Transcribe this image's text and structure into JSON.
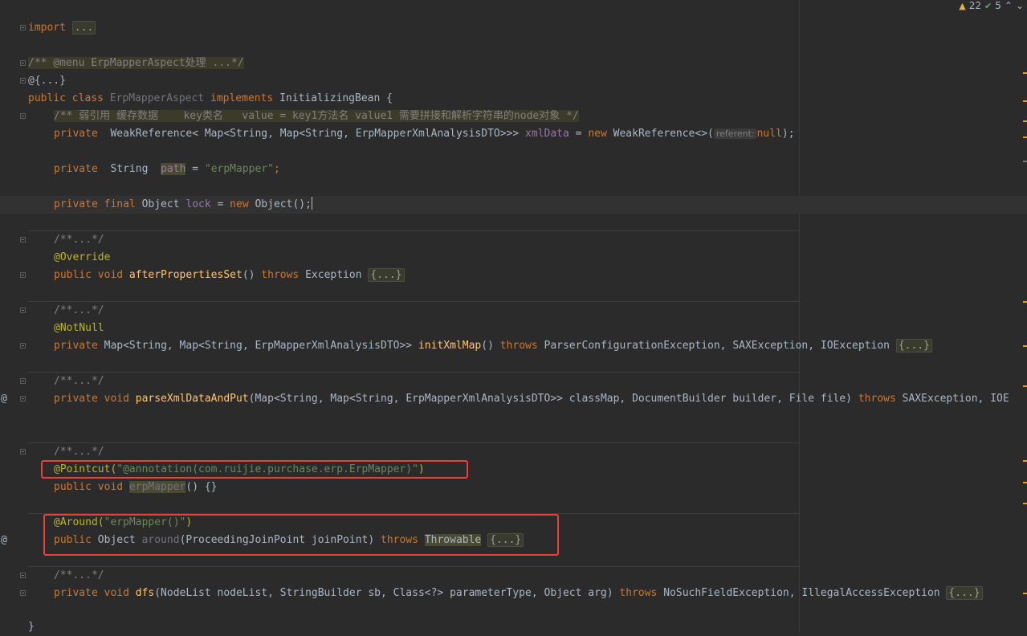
{
  "status": {
    "warnings": "22",
    "ok": "5",
    "up_arrow": "⌃",
    "down_arrow": "⌄"
  },
  "code": {
    "l_import": "import",
    "l_import_fold": "...",
    "l_menu_comment": "/** @menu ErpMapperAspect处理 ...*/",
    "l_annot_fold": "@{...}",
    "l_class_public": "public class",
    "l_class_name": "ErpMapperAspect",
    "l_class_impl": "implements",
    "l_class_iface": "InitializingBean {",
    "l_weak_comment": "/** 弱引用 缓存数据    key类名   value = key1方法名 value1 需要拼接和解析字符串的node对象 */",
    "l_weak_private": "private",
    "l_weak_type1": "WeakReference<",
    "l_weak_map1": "Map",
    "l_weak_type2": "<String, ",
    "l_weak_map2": "Map",
    "l_weak_type3": "<String, ErpMapperXmlAnalysisDTO",
    "l_weak_gt": ">>>",
    "l_weak_field": "xmlData",
    "l_weak_eq": " = ",
    "l_weak_new": "new",
    "l_weak_ctor": "WeakReference<>(",
    "l_weak_hint": "referent:",
    "l_weak_null": "null",
    "l_weak_end": ");",
    "l_path_private": "private",
    "l_path_type": "String",
    "l_path_field": "path",
    "l_path_eq": " = ",
    "l_path_val": "\"erpMapper\"",
    "l_path_end": ";",
    "l_lock_mods": "private final",
    "l_lock_type": "Object",
    "l_lock_field": "lock",
    "l_lock_eq": " = ",
    "l_lock_new": "new",
    "l_lock_ctor": "Object();",
    "l_doc1": "/**...*/",
    "l_override": "@Override",
    "l_aps_mods": "public void",
    "l_aps_name": "afterPropertiesSet",
    "l_aps_paren": "() ",
    "l_aps_throws": "throws",
    "l_aps_exc": "Exception",
    "l_aps_fold": "{...}",
    "l_doc2": "/**...*/",
    "l_notnull": "@NotNull",
    "l_init_private": "private",
    "l_init_sig1": "Map<String, ",
    "l_init_map": "Map",
    "l_init_sig2": "<String, ErpMapperXmlAnalysisDTO",
    "l_init_gt": ">>",
    "l_init_name": "initXmlMap",
    "l_init_paren": "() ",
    "l_init_throws": "throws",
    "l_init_exc": "ParserConfigurationException, SAXException, IOException",
    "l_init_fold": "{...}",
    "l_doc3": "/**...*/",
    "l_parse_mods": "private void",
    "l_parse_name": "parseXmlDataAndPut",
    "l_parse_sig1": "(Map<String, ",
    "l_parse_map": "Map",
    "l_parse_sig2": "<String, ErpMapperXmlAnalysisDTO",
    "l_parse_gt": ">>",
    "l_parse_sig3": " classMap, DocumentBuilder builder, File file) ",
    "l_parse_throws": "throws",
    "l_parse_exc": "SAXException, IOE",
    "l_doc4": "/**...*/",
    "l_pointcut_ann": "@Pointcut(",
    "l_pointcut_val": "\"@annotation(com.ruijie.purchase.erp.ErpMapper)\"",
    "l_pointcut_end": ")",
    "l_pc_mods": "public void",
    "l_pc_name": "erpMapper",
    "l_pc_body": "() {}",
    "l_around_ann": "@Around(",
    "l_around_val": "\"erpMapper()\"",
    "l_around_end": ")",
    "l_around_mods": "public",
    "l_around_type": "Object",
    "l_around_name": "around",
    "l_around_params": "(ProceedingJoinPoint joinPoint) ",
    "l_around_throws": "throws",
    "l_around_exc": "Throwable",
    "l_around_fold": "{...}",
    "l_doc5": "/**...*/",
    "l_dfs_mods": "private void",
    "l_dfs_name": "dfs",
    "l_dfs_params": "(NodeList nodeList, StringBuilder sb, Class<?> parameterType, Object arg) ",
    "l_dfs_throws": "throws",
    "l_dfs_exc": "NoSuchFieldException, IllegalAccessException",
    "l_dfs_fold": "{...}",
    "l_close": "}"
  }
}
